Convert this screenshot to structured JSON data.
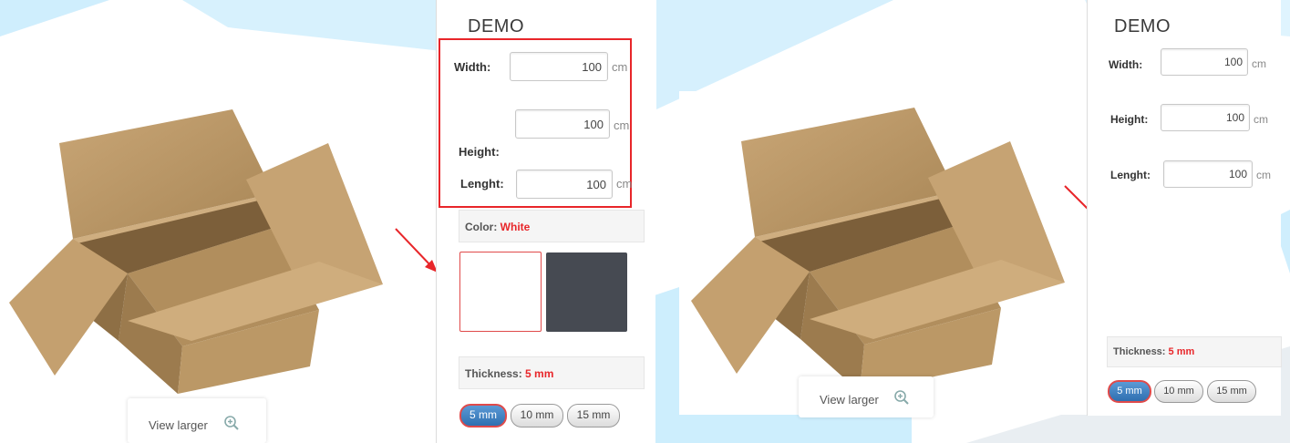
{
  "colors": {
    "accent_red": "#e8262a",
    "selected_blue": "#3a7fc4",
    "swatch_dark": "#464a52",
    "bg_blue": "#cfeefd"
  },
  "left": {
    "title": "DEMO",
    "width": {
      "label": "Width:",
      "value": "100",
      "unit": "cm"
    },
    "height": {
      "label": "Height:",
      "value": "100",
      "unit": "cm"
    },
    "length": {
      "label": "Lenght:",
      "value": "100",
      "unit": "cm"
    },
    "color": {
      "label": "Color:",
      "value": "White"
    },
    "thickness": {
      "label": "Thickness:",
      "value": "5 mm"
    },
    "thickness_options": [
      "5 mm",
      "10 mm",
      "15 mm"
    ],
    "view_larger": "View larger"
  },
  "right": {
    "title": "DEMO",
    "width": {
      "label": "Width:",
      "value": "100",
      "unit": "cm"
    },
    "height": {
      "label": "Height:",
      "value": "100",
      "unit": "cm"
    },
    "length": {
      "label": "Lenght:",
      "value": "100",
      "unit": "cm"
    },
    "thickness": {
      "label": "Thickness:",
      "value": "5 mm"
    },
    "thickness_options": [
      "5 mm",
      "10 mm",
      "15 mm"
    ],
    "view_larger": "View larger"
  }
}
